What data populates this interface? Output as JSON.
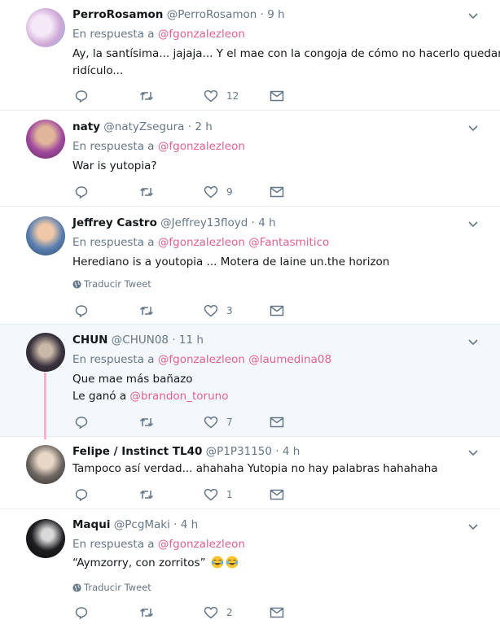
{
  "tweets": [
    {
      "name": "PerroRosamon",
      "handle": "@PerroRosamon",
      "time": "· 9 h",
      "reply_prefix": "En respuesta a",
      "reply_to": "@fgonzalezleon",
      "text_lines": [
        "Ay, la santísima... jajaja... Y el mae con la congoja de cómo no hacerlo quedar en",
        "ridículo..."
      ],
      "likes": "12",
      "avatar_color": "#cfa7d6"
    },
    {
      "name": "naty",
      "handle": "@natyZsegura",
      "time": "· 2 h",
      "reply_prefix": "En respuesta a",
      "reply_to": "@fgonzalezleon",
      "text_lines": [
        "War is yutopia?"
      ],
      "likes": "9",
      "avatar_color": "#a24a9e"
    },
    {
      "name": "Jeffrey Castro",
      "handle": "@Jeffrey13floyd",
      "time": "· 4 h",
      "reply_prefix": "En respuesta a",
      "reply_to": "@fgonzalezleon",
      "reply_to_2": "@Fantasmitico",
      "text_lines": [
        "Herediano is a youtopia ... Motera de laine un.the horizon"
      ],
      "translate": "Traducir Tweet",
      "likes": "3",
      "avatar_color": "#5a7fb0"
    },
    {
      "name": "CHUN",
      "handle": "@CHUN08",
      "time": "· 11 h",
      "reply_prefix": "En respuesta a",
      "reply_to": "@fgonzalezleon",
      "reply_to_2": "@laumedina08",
      "text_lines": [
        "Que mae más bañazo"
      ],
      "text_line2_prefix": "Le ganó a",
      "text_line2_mention": "@brandon_toruno",
      "likes": "7",
      "avatar_color": "#3b3440"
    },
    {
      "name": "Felipe / Instinct TL40",
      "handle": "@P1P31150",
      "time": "· 4 h",
      "text_lines": [
        "Tampoco así verdad... ahahaha Yutopia no hay palabras hahahaha"
      ],
      "likes": "1",
      "avatar_color": "#6c6660"
    },
    {
      "name": "Maqui",
      "handle": "@PcgMaki",
      "time": "· 4 h",
      "reply_prefix": "En respuesta a",
      "reply_to": "@fgonzalezleon",
      "text_lines": [
        "“Aymzorry, con zorritos”"
      ],
      "translate": "Traducir Tweet",
      "likes": "2",
      "avatar_color": "#1e1e22"
    }
  ]
}
